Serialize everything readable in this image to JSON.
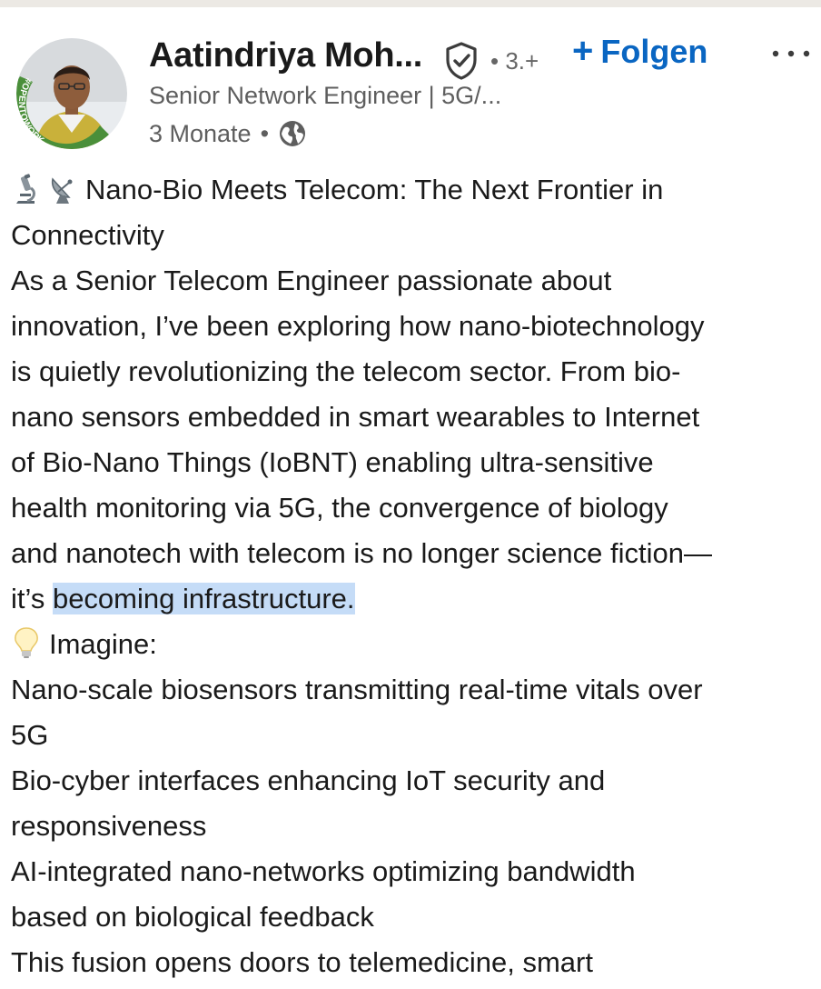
{
  "author": {
    "name": "Aatindriya Moh...",
    "degree": "• 3.+",
    "headline": "Senior Network Engineer | 5G/...",
    "time": "3 Monate",
    "separator": "•",
    "avatar_badge_text": "#OPENTOWORK"
  },
  "actions": {
    "follow_plus": "+",
    "follow_label": "Folgen"
  },
  "icons": {
    "verified": "shield-check-icon",
    "more": "more-horizontal-icon",
    "visibility": "globe-icon",
    "microscope": "microscope-emoji-icon",
    "satellite": "satellite-dish-emoji-icon",
    "bulb": "light-bulb-emoji-icon"
  },
  "post": {
    "lines": [
      "Nano-Bio Meets Telecom: The Next Frontier in",
      "Connectivity",
      "As a Senior Telecom Engineer passionate about",
      "innovation, I’ve been exploring how nano-biotechnology",
      "is quietly revolutionizing the telecom sector. From bio-",
      "nano sensors embedded in smart wearables to Internet",
      "of Bio-Nano Things (IoBNT) enabling ultra-sensitive",
      "health monitoring via 5G, the convergence of biology",
      "and nanotech with telecom is no longer science fiction—",
      "it’s ",
      "becoming infrastructure.",
      "Imagine:",
      "Nano-scale biosensors transmitting real-time vitals over",
      "5G",
      "Bio-cyber interfaces enhancing IoT security and",
      "responsiveness",
      "AI-integrated nano-networks optimizing bandwidth",
      "based on biological feedback",
      "This fusion opens doors to telemedicine, smart"
    ]
  },
  "colors": {
    "accent": "#0a66c2",
    "opentowork_green": "#4a8f3a",
    "selection": "#c5dcf7",
    "secondary_text": "#5e5e5e"
  }
}
